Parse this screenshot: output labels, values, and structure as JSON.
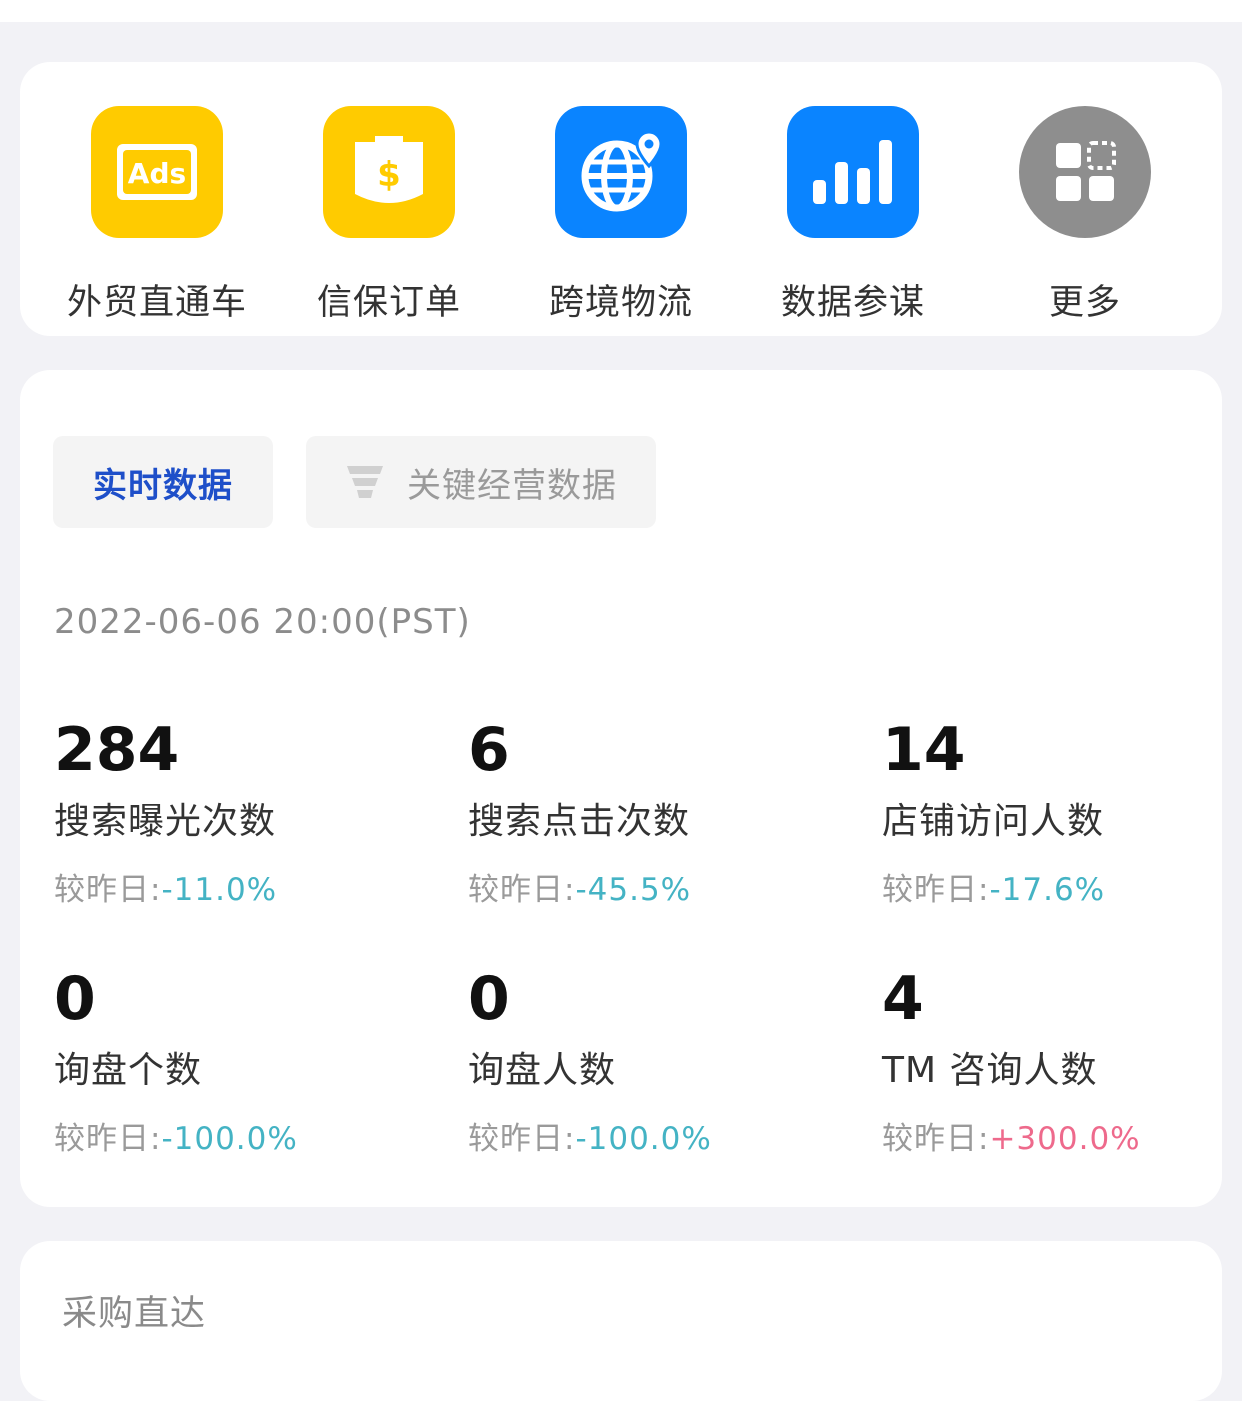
{
  "colors": {
    "yellow": "#FFCB00",
    "blue": "#0A84FF",
    "gray": "#8E8E8E",
    "negative": "#44B3C4",
    "positive": "#EE6A8C",
    "active_tab": "#1E4FC9"
  },
  "shortcuts": [
    {
      "label": "外贸直通车",
      "icon": "ads-icon",
      "icon_text": "Ads"
    },
    {
      "label": "信保订单",
      "icon": "trade-assurance-icon"
    },
    {
      "label": "跨境物流",
      "icon": "globe-location-icon"
    },
    {
      "label": "数据参谋",
      "icon": "bar-chart-icon"
    },
    {
      "label": "更多",
      "icon": "grid-more-icon"
    }
  ],
  "tabs": {
    "realtime": "实时数据",
    "key_data": "关键经营数据",
    "key_data_icon": "funnel-icon"
  },
  "timestamp": "2022-06-06 20:00(PST)",
  "compare_prefix": "较昨日:",
  "metrics": [
    {
      "value": "284",
      "label": "搜索曝光次数",
      "change": "-11.0%"
    },
    {
      "value": "6",
      "label": "搜索点击次数",
      "change": "-45.5%"
    },
    {
      "value": "14",
      "label": "店铺访问人数",
      "change": "-17.6%"
    },
    {
      "value": "0",
      "label": "询盘个数",
      "change": "-100.0%"
    },
    {
      "value": "0",
      "label": "询盘人数",
      "change": "-100.0%"
    },
    {
      "value": "4",
      "label": "TM 咨询人数",
      "change": "+300.0%"
    }
  ],
  "procurement": {
    "title": "采购直达"
  }
}
